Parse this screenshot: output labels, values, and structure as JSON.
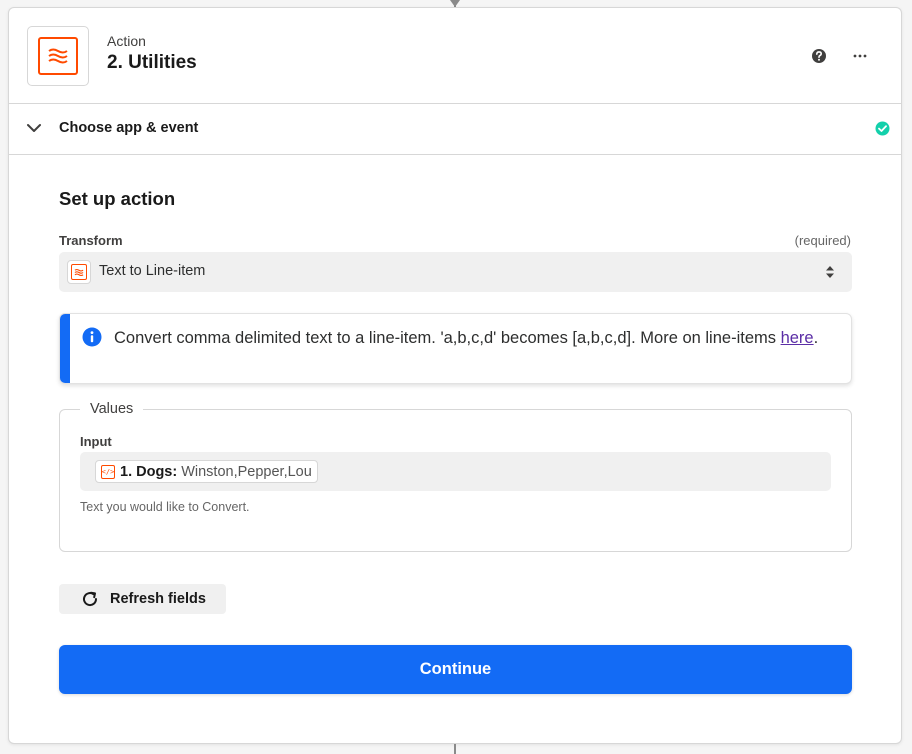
{
  "header": {
    "type_label": "Action",
    "title": "2. Utilities",
    "icon": "utilities-icon"
  },
  "section": {
    "label": "Choose app & event",
    "status_icon": "check-circle-icon",
    "status_color": "#13d0ab"
  },
  "setup": {
    "title": "Set up action",
    "transform": {
      "label": "Transform",
      "required_label": "(required)",
      "selected_value": "Text to Line-item"
    },
    "info": {
      "text": "Convert comma delimited text to a line-item. 'a,b,c,d' becomes [a,b,c,d]. More on line-items ",
      "link_text": "here",
      "trailing": "."
    },
    "values": {
      "legend": "Values",
      "input_label": "Input",
      "pill_label": "1. Dogs:",
      "pill_value": "Winston,Pepper,Lou",
      "help_text": "Text you would like to Convert."
    },
    "refresh_label": "Refresh fields",
    "continue_label": "Continue"
  },
  "colors": {
    "brand_orange": "#ff4a00",
    "primary_blue": "#136bf5",
    "link_purple": "#5b2ea6",
    "success_green": "#13d0ab"
  }
}
